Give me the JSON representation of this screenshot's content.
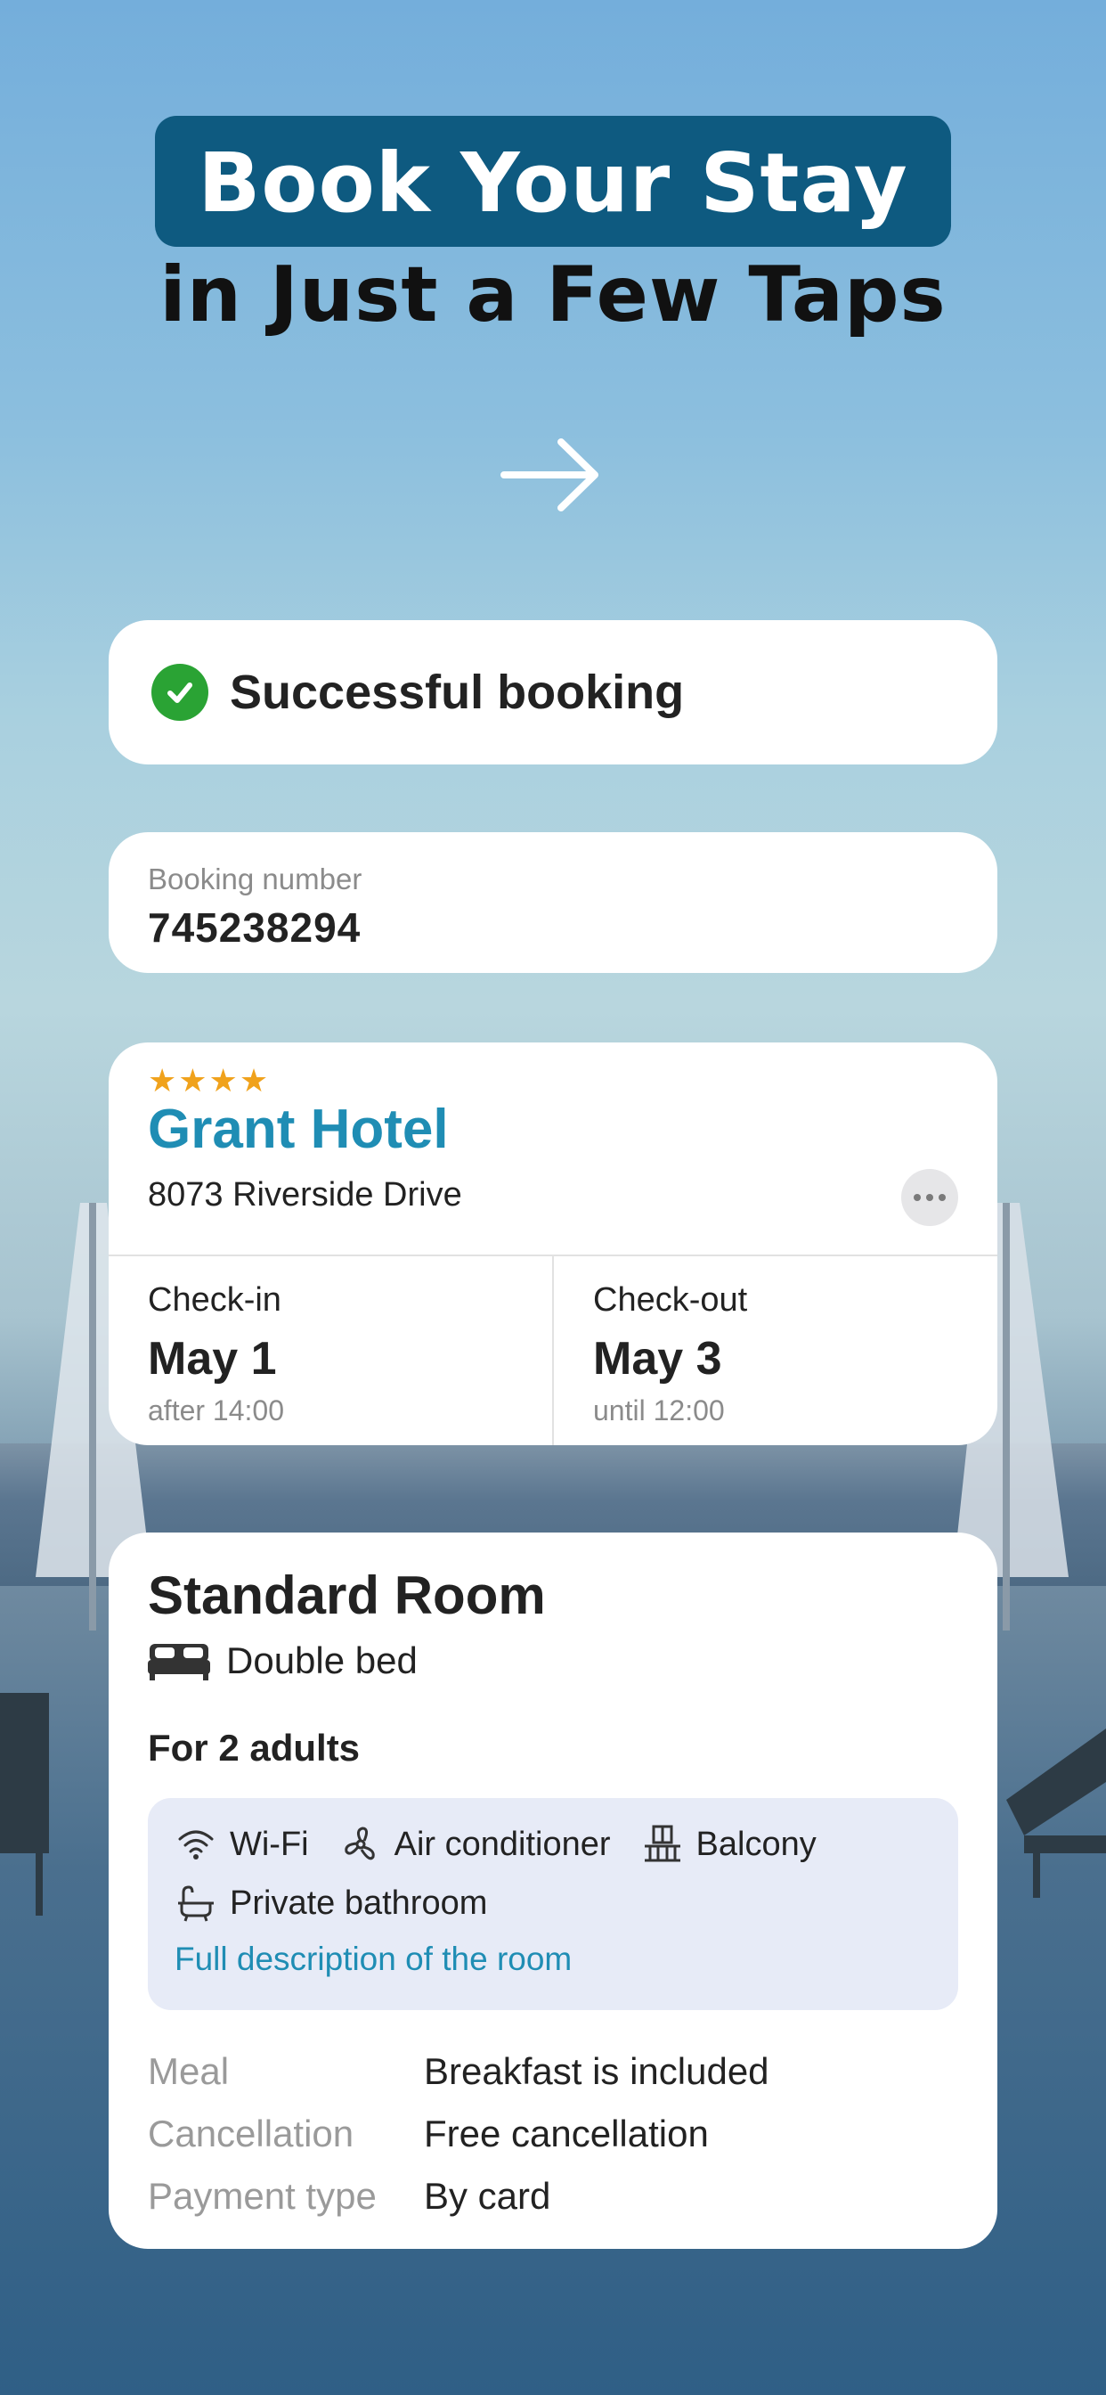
{
  "headline": {
    "title": "Book Your Stay",
    "subtitle": "in Just a Few Taps"
  },
  "status": {
    "text": "Successful booking",
    "icon": "check-circle-icon",
    "color": "#2aa334"
  },
  "booking": {
    "label": "Booking number",
    "number": "745238294"
  },
  "hotel": {
    "stars": "★★★★",
    "rating": 4,
    "name": "Grant Hotel",
    "address": "8073 Riverside Drive",
    "accent_color": "#1f8db4",
    "checkin": {
      "label": "Check-in",
      "date": "May 1",
      "time": "after 14:00"
    },
    "checkout": {
      "label": "Check-out",
      "date": "May 3",
      "time": "until 12:00"
    }
  },
  "room": {
    "title": "Standard Room",
    "bed": "Double bed",
    "guests": "For 2 adults",
    "amenities": [
      {
        "icon": "wifi-icon",
        "label": "Wi-Fi"
      },
      {
        "icon": "fan-icon",
        "label": "Air conditioner"
      },
      {
        "icon": "balcony-icon",
        "label": "Balcony"
      },
      {
        "icon": "bathtub-icon",
        "label": "Private bathroom"
      }
    ],
    "description_link": "Full description of the room",
    "details": [
      {
        "key": "Meal",
        "value": "Breakfast is included"
      },
      {
        "key": "Cancellation",
        "value": "Free cancellation"
      },
      {
        "key": "Payment type",
        "value": "By card"
      }
    ]
  }
}
